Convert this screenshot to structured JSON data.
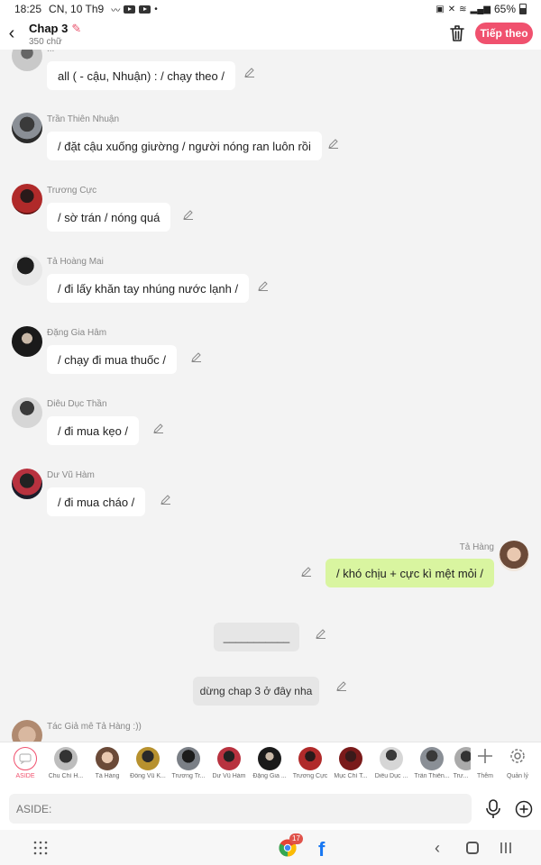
{
  "status": {
    "time": "18:25",
    "date": "CN, 10 Th9",
    "battery": "65%"
  },
  "header": {
    "title": "Chap 3",
    "subtitle": "350 chữ",
    "next_label": "Tiếp theo"
  },
  "messages": [
    {
      "name": "...",
      "text": "all ( - cậu, Nhuận) : / chạy theo /"
    },
    {
      "name": "Trần Thiên Nhuận",
      "text": "/ đặt cậu xuống giường / người nóng ran luôn rồi"
    },
    {
      "name": "Trương Cực",
      "text": "/ sờ trán / nóng quá"
    },
    {
      "name": "Tả Hoàng Mai",
      "text": "/ đi lấy khăn tay nhúng nước lạnh /"
    },
    {
      "name": "Đặng Gia Hâm",
      "text": "/ chạy đi mua thuốc /"
    },
    {
      "name": "Diêu Dục Thần",
      "text": "/ đi mua kẹo /"
    },
    {
      "name": "Dư Vũ Hàm",
      "text": "/ đi mua cháo /"
    }
  ],
  "self_message": {
    "name": "Tả Hàng",
    "text": "/ khó chịu + cực kì mệt mỏi /"
  },
  "asides": [
    {
      "text": "___________"
    },
    {
      "text": "dừng chap 3 ở đây nha"
    }
  ],
  "last_partial": {
    "name": "Tác Giả mê Tả Hàng :))"
  },
  "characters": [
    {
      "label": "ASIDE"
    },
    {
      "label": "Chu Chí H..."
    },
    {
      "label": "Tả Hàng"
    },
    {
      "label": "Đồng Vũ K..."
    },
    {
      "label": "Trương Tr..."
    },
    {
      "label": "Dư Vũ Hàm"
    },
    {
      "label": "Đặng Gia ..."
    },
    {
      "label": "Trương Cực"
    },
    {
      "label": "Mục Chí T..."
    },
    {
      "label": "Diêu Dục ..."
    },
    {
      "label": "Trần Thiên..."
    },
    {
      "label": "Trư..."
    }
  ],
  "tools": {
    "add_label": "Thêm",
    "manage_label": "Quản lý"
  },
  "input": {
    "placeholder": "ASIDE:"
  },
  "nav": {
    "chrome_badge": "17",
    "fb_glyph": "f"
  },
  "colors": {
    "accent": "#f0516e",
    "self_bubble": "#d9f5a0"
  }
}
